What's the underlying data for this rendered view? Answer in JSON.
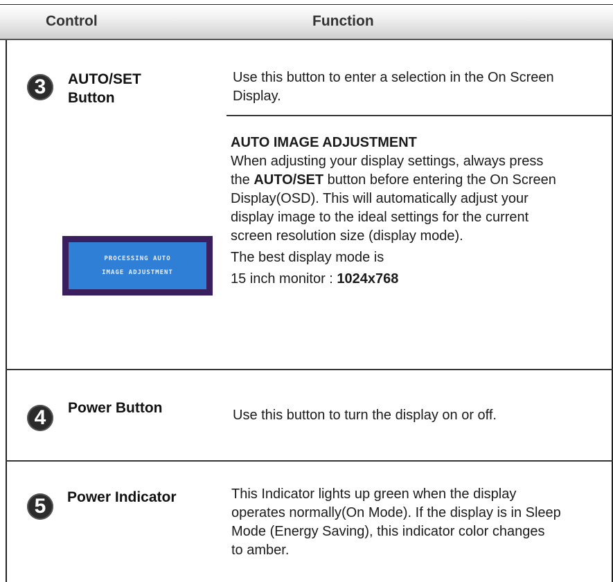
{
  "header": {
    "control": "Control",
    "function": "Function"
  },
  "rows": [
    {
      "number": "3",
      "label_line1": "AUTO/SET",
      "label_line2": "Button",
      "desc_line1": "Use this button to enter a selection in the On Screen",
      "desc_line2": "Display.",
      "sub_title": "AUTO IMAGE ADJUSTMENT",
      "sub_line1": "When adjusting your display settings, always press",
      "sub_line2_pre": "the ",
      "sub_line2_bold": "AUTO/SET",
      "sub_line2_post": " button before entering the On Screen",
      "sub_line3": "Display(OSD). This will automatically adjust your",
      "sub_line4": "display image to the ideal settings for the current",
      "sub_line5": "screen resolution size (display mode).",
      "best_mode": "The best display mode is",
      "monitor_pre": "15 inch monitor : ",
      "monitor_value": "1024x768",
      "osd_line1": "PROCESSING AUTO",
      "osd_line2": "IMAGE ADJUSTMENT"
    },
    {
      "number": "4",
      "label": "Power Button",
      "desc": "Use this button to turn the display on or off."
    },
    {
      "number": "5",
      "label": "Power Indicator",
      "desc_line1": "This Indicator lights up green when the display",
      "desc_line2": "operates normally(On Mode). If the display is in Sleep",
      "desc_line3": "Mode (Energy Saving), this indicator color changes",
      "desc_line4": "to amber."
    }
  ]
}
